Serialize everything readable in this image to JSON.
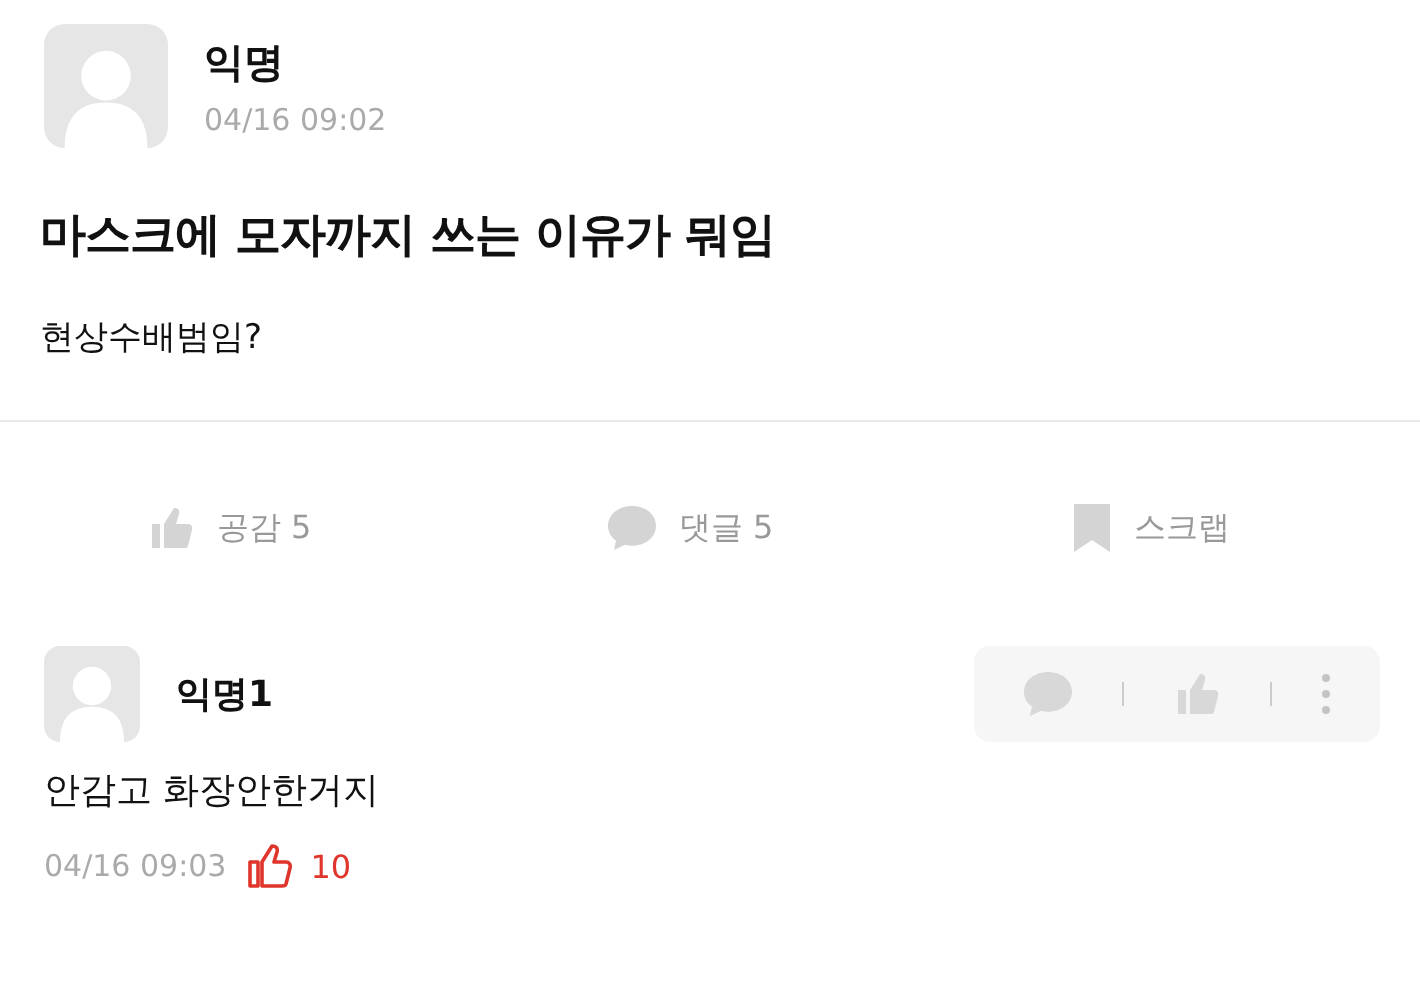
{
  "post": {
    "author": "익명",
    "time": "04/16 09:02",
    "title": "마스크에 모자까지 쓰는 이유가 뭐임",
    "body": "현상수배범임?"
  },
  "actions": [
    {
      "kind": "like",
      "label": "공감 5"
    },
    {
      "kind": "comment",
      "label": "댓글 5"
    },
    {
      "kind": "scrap",
      "label": "스크랩"
    }
  ],
  "comments": [
    {
      "author": "익명1",
      "text": "안감고 화장안한거지",
      "time": "04/16 09:03",
      "likes": "10"
    }
  ]
}
